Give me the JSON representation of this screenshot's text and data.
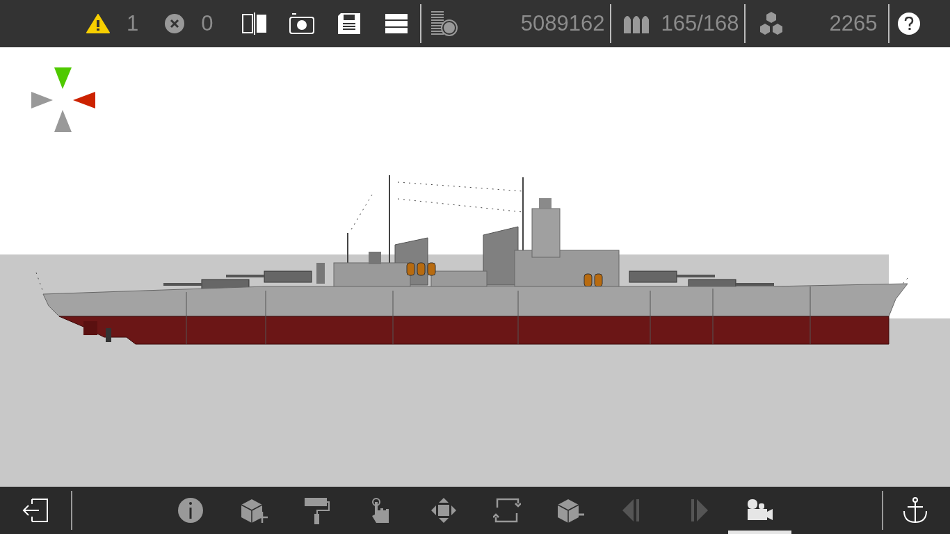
{
  "top_bar": {
    "warnings": "1",
    "errors": "0",
    "buttons": [
      {
        "kind": "split-view"
      },
      {
        "kind": "screenshot"
      },
      {
        "kind": "save"
      },
      {
        "kind": "menu"
      }
    ],
    "stats_button": {
      "kind": "stats"
    },
    "cost": "5089162",
    "ammo": "165/168",
    "blocks": "2265"
  },
  "bottom_bar": {
    "tools": [
      {
        "kind": "info",
        "selected": false,
        "disabled": false
      },
      {
        "kind": "add-block",
        "selected": false,
        "disabled": false
      },
      {
        "kind": "paint",
        "selected": false,
        "disabled": false
      },
      {
        "kind": "select",
        "selected": false,
        "disabled": false
      },
      {
        "kind": "move",
        "selected": false,
        "disabled": false
      },
      {
        "kind": "rotate",
        "selected": false,
        "disabled": false
      },
      {
        "kind": "remove-block",
        "selected": false,
        "disabled": false
      },
      {
        "kind": "prev",
        "selected": false,
        "disabled": true
      },
      {
        "kind": "next",
        "selected": false,
        "disabled": true
      },
      {
        "kind": "camera",
        "selected": true,
        "disabled": false
      }
    ]
  }
}
